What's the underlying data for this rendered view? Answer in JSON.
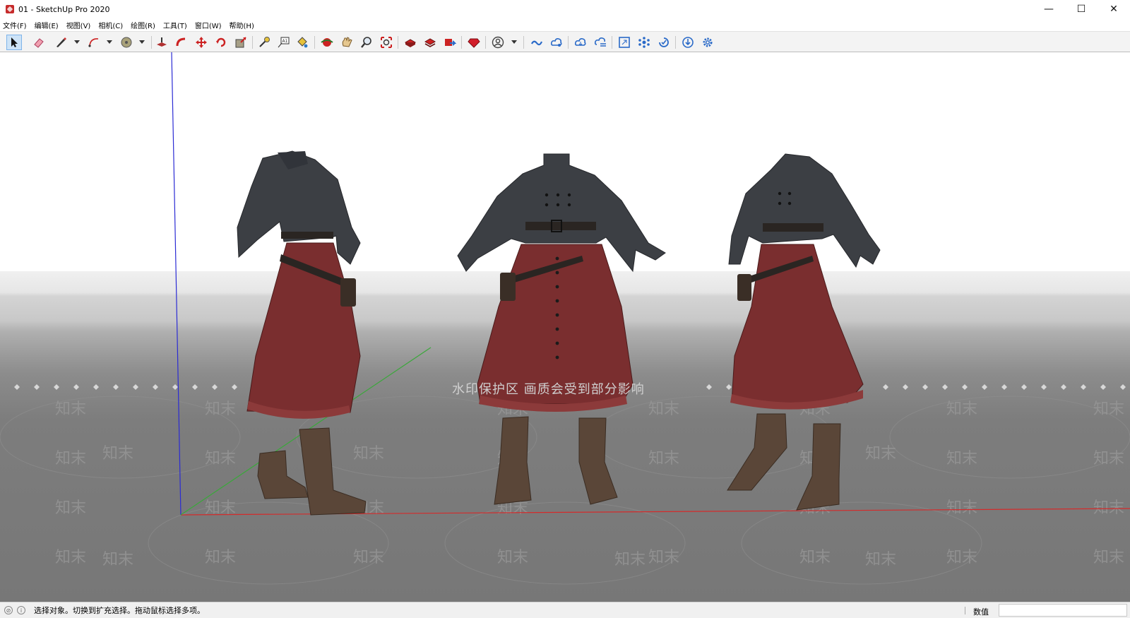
{
  "window": {
    "title": "01 - SketchUp Pro 2020",
    "controls": {
      "minimize": "—",
      "maximize": "☐",
      "close": "✕"
    }
  },
  "menu": [
    "文件(F)",
    "编辑(E)",
    "视图(V)",
    "相机(C)",
    "绘图(R)",
    "工具(T)",
    "窗口(W)",
    "帮助(H)"
  ],
  "toolbar": {
    "active_tool": "select-tool",
    "tools": [
      "select-tool",
      "eraser-tool",
      "line-tool",
      "arc-tool",
      "circle-tool",
      "push-pull-tool",
      "follow-me-tool",
      "move-tool",
      "rotate-tool",
      "scale-tool",
      "tape-measure-tool",
      "text-tool",
      "paint-bucket-tool",
      "orbit-tool",
      "pan-tool",
      "zoom-tool",
      "zoom-extents-tool",
      "warehouse-icon",
      "extension-warehouse-icon",
      "send-to-layout-icon",
      "ruby-console-icon",
      "account-icon",
      "trimble-connect-icon",
      "trimble-share-icon",
      "cloud-open-icon",
      "cloud-publish-icon",
      "screen-icon",
      "nodes-icon",
      "sync-icon",
      "download-icon",
      "settings-gear-icon"
    ]
  },
  "viewport": {
    "watermark_banner": "水印保护区   画质会受到部分影响",
    "watermark_tile": "知末",
    "colors": {
      "blouse": "#3c3f44",
      "skirt": "#7a2e2f",
      "boots": "#5a4638",
      "belt": "#2a2522",
      "red_axis": "#d42b2b",
      "green_axis": "#3aa83a",
      "blue_axis": "#2b2bd4"
    }
  },
  "statusbar": {
    "message": "选择对象。切换到扩充选择。拖动鼠标选择多项。",
    "measure_label": "数值",
    "measure_value": ""
  }
}
